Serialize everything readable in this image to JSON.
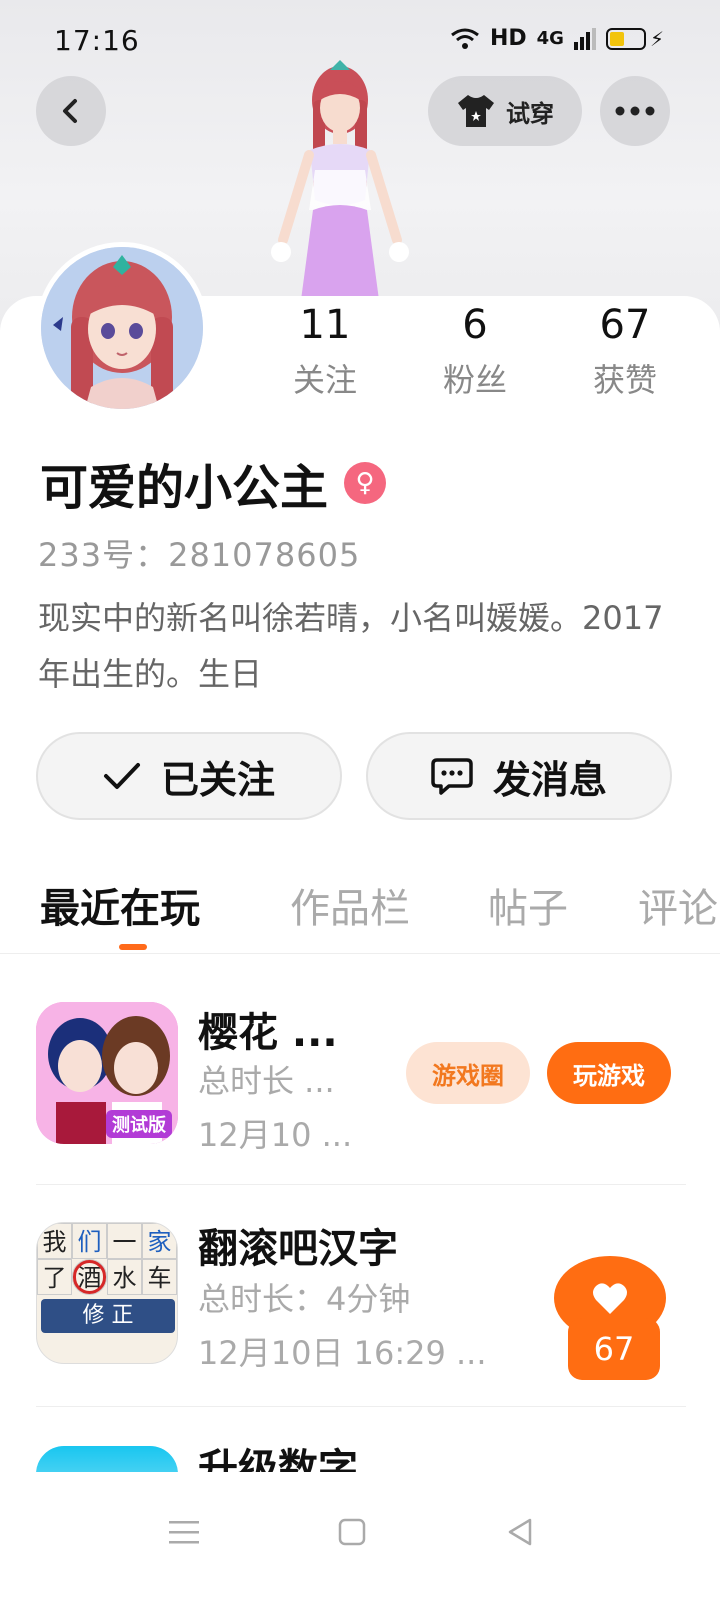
{
  "status_bar": {
    "time": "17:16",
    "hd": "HD",
    "network": "4G"
  },
  "header": {
    "tryon_label": "试穿"
  },
  "profile": {
    "stats": [
      {
        "value": "11",
        "label": "关注"
      },
      {
        "value": "6",
        "label": "粉丝"
      },
      {
        "value": "67",
        "label": "获赞"
      }
    ],
    "username": "可爱的小公主",
    "uid": "233号：281078605",
    "bio": "现实中的新名叫徐若晴，小名叫媛媛。2017年出生的。生日"
  },
  "actions": {
    "follow_label": "已关注",
    "message_label": "发消息"
  },
  "tabs": [
    {
      "label": "最近在玩"
    },
    {
      "label": "作品栏"
    },
    {
      "label": "帖子"
    },
    {
      "label": "评论"
    }
  ],
  "games": [
    {
      "title": "樱花 ...",
      "duration": "总时长 ...",
      "date": "12月10 ...",
      "icon_badge": "测试版",
      "circle_label": "游戏圈",
      "play_label": "玩游戏"
    },
    {
      "title": "翻滚吧汉字",
      "duration": "总时长：4分钟",
      "date": "12月10日 16:29 ...",
      "icon_chars": [
        "我",
        "们",
        "一",
        "家",
        "了",
        "酒",
        "水",
        "车"
      ],
      "icon_banner": "修 正"
    },
    {
      "title": "升级数字"
    }
  ],
  "like_fab": {
    "count": "67"
  },
  "colors": {
    "accent": "#ff6d12",
    "gender_badge": "#f5677f"
  }
}
